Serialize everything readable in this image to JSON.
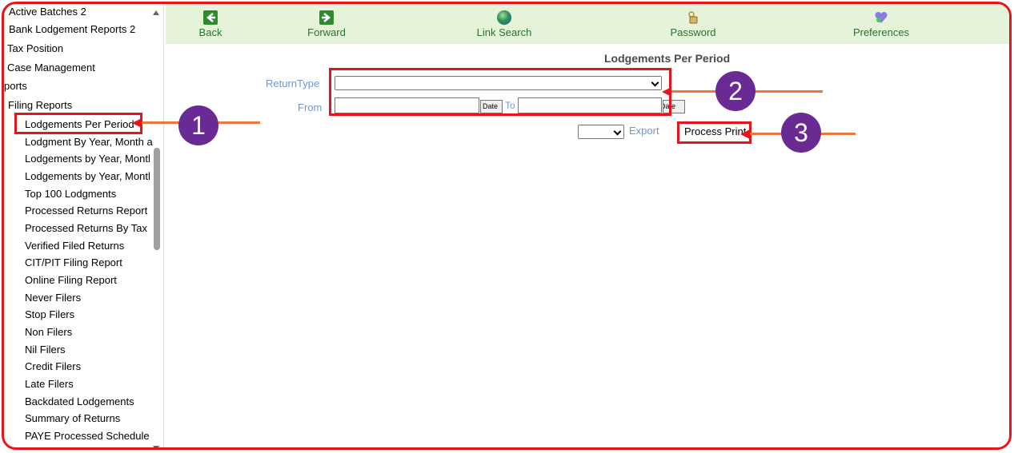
{
  "sidebar": {
    "items": [
      {
        "label": "Active Batches 2"
      },
      {
        "label": "Bank Lodgement Reports 2"
      },
      {
        "label": "Tax Position"
      },
      {
        "label": "Case Management"
      },
      {
        "label": "ports"
      },
      {
        "label": "Filing Reports"
      },
      {
        "label": "Lodgements Per Period"
      },
      {
        "label": "Lodgment By Year, Month a"
      },
      {
        "label": "Lodgements by Year, Montl"
      },
      {
        "label": "Lodgements by Year, Montl"
      },
      {
        "label": "Top 100 Lodgments"
      },
      {
        "label": "Processed Returns Report"
      },
      {
        "label": "Processed Returns By Tax"
      },
      {
        "label": "Verified Filed Returns"
      },
      {
        "label": "CIT/PIT Filing Report"
      },
      {
        "label": "Online Filing Report"
      },
      {
        "label": "Never Filers"
      },
      {
        "label": "Stop Filers"
      },
      {
        "label": "Non Filers"
      },
      {
        "label": "Nil Filers"
      },
      {
        "label": "Credit Filers"
      },
      {
        "label": "Late Filers"
      },
      {
        "label": "Backdated Lodgements"
      },
      {
        "label": "Summary of Returns"
      },
      {
        "label": "PAYE Processed Schedule"
      }
    ]
  },
  "toolbar": {
    "back": "Back",
    "forward": "Forward",
    "link_search": "Link Search",
    "password": "Password",
    "preferences": "Preferences"
  },
  "main": {
    "title": "Lodgements Per Period",
    "return_type_label": "ReturnType",
    "return_type_value": "",
    "from_label": "From",
    "from_value": "",
    "date_button": "Date",
    "to_label": "To",
    "to_value": "",
    "date_button_2": "Date",
    "export_format_value": "",
    "export_label": "Export",
    "process_print": "Process Print"
  },
  "annotations": {
    "badge_1": "1",
    "badge_2": "2",
    "badge_3": "3",
    "highlight_color": "#e8141b",
    "badge_color": "#6a2a93",
    "arrow_color": "#ea7a3b"
  }
}
